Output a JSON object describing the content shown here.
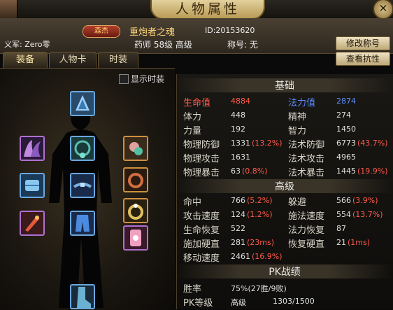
{
  "window": {
    "title": "人物属性",
    "close_icon": "close-icon"
  },
  "header": {
    "rank_badge": "森杰",
    "name": "重炮者之魂",
    "id_text": "ID:20153620",
    "guild_text": "义军: Zero零",
    "job_text": "药师 58级 高级",
    "nick_label": "称号: 无",
    "btn_rename": "修改称号",
    "btn_resist": "查看抗性"
  },
  "tabs": [
    "装备",
    "人物卡",
    "时装"
  ],
  "fashion_toggle": {
    "label": "显示时装",
    "checked": false
  },
  "sections": {
    "basic": "基础",
    "advanced": "高级",
    "pk": "PK战绩"
  },
  "basic_stats": [
    {
      "l1": "生命值",
      "v1": "4884",
      "l2": "法力值",
      "v2": "2874",
      "p1": "",
      "p2": ""
    },
    {
      "l1": "体力",
      "v1": "448",
      "l2": "精神",
      "v2": "274",
      "p1": "",
      "p2": ""
    },
    {
      "l1": "力量",
      "v1": "192",
      "l2": "智力",
      "v2": "1450",
      "p1": "",
      "p2": ""
    },
    {
      "l1": "物理防御",
      "v1": "1331",
      "p1": "(13.2%)",
      "l2": "法术防御",
      "v2": "6773",
      "p2": "(43.7%)"
    },
    {
      "l1": "物理攻击",
      "v1": "1631",
      "p1": "",
      "l2": "法术攻击",
      "v2": "4965",
      "p2": ""
    },
    {
      "l1": "物理暴击",
      "v1": "63",
      "p1": "(0.8%)",
      "l2": "法术暴击",
      "v2": "1445",
      "p2": "(19.9%)"
    }
  ],
  "advanced_stats": [
    {
      "l1": "命中",
      "v1": "766",
      "p1": "(5.2%)",
      "l2": "躲避",
      "v2": "566",
      "p2": "(3.9%)"
    },
    {
      "l1": "攻击速度",
      "v1": "124",
      "p1": "(1.2%)",
      "l2": "施法速度",
      "v2": "554",
      "p2": "(13.7%)"
    },
    {
      "l1": "生命恢复",
      "v1": "522",
      "p1": "",
      "l2": "法力恢复",
      "v2": "87",
      "p2": ""
    },
    {
      "l1": "施加硬直",
      "v1": "281",
      "p1": "(23ms)",
      "l2": "恢复硬直",
      "v2": "21",
      "p2": "(1ms)"
    },
    {
      "l1": "移动速度",
      "v1": "2461",
      "p1": "(16.9%)",
      "l2": "",
      "v2": "",
      "p2": ""
    }
  ],
  "pk_stats": [
    {
      "label": "胜率",
      "value": "75%(27胜/9败)"
    },
    {
      "label": "PK等级",
      "value": "高级",
      "extra": "1303/1500"
    }
  ],
  "colors": {
    "hp": "#ff5a4a",
    "mp": "#5a8cff",
    "percent": "#ff5a4a",
    "gold": "#ffd57a"
  }
}
